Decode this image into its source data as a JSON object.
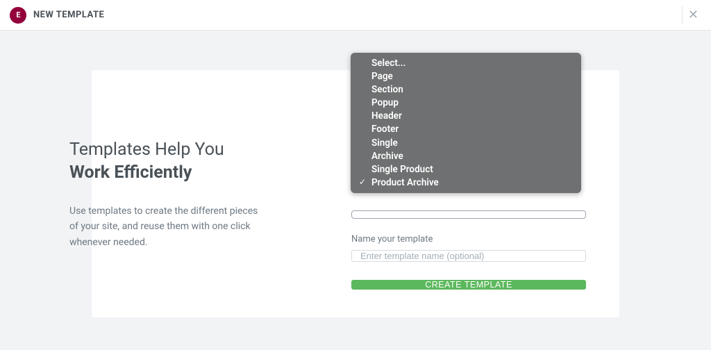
{
  "header": {
    "title": "NEW TEMPLATE",
    "logo_text": "E"
  },
  "left": {
    "heading_line1": "Templates Help You",
    "heading_line2": "Work Efficiently",
    "description": "Use templates to create the different pieces of your site, and reuse them with one click whenever needed."
  },
  "form": {
    "name_label": "Name your template",
    "name_placeholder": "Enter template name (optional)",
    "submit_label": "CREATE TEMPLATE"
  },
  "dropdown": {
    "options": [
      {
        "label": "Select...",
        "selected": false
      },
      {
        "label": "Page",
        "selected": false
      },
      {
        "label": "Section",
        "selected": false
      },
      {
        "label": "Popup",
        "selected": false
      },
      {
        "label": "Header",
        "selected": false
      },
      {
        "label": "Footer",
        "selected": false
      },
      {
        "label": "Single",
        "selected": false
      },
      {
        "label": "Archive",
        "selected": false
      },
      {
        "label": "Single Product",
        "selected": false
      },
      {
        "label": "Product Archive",
        "selected": true
      }
    ]
  }
}
